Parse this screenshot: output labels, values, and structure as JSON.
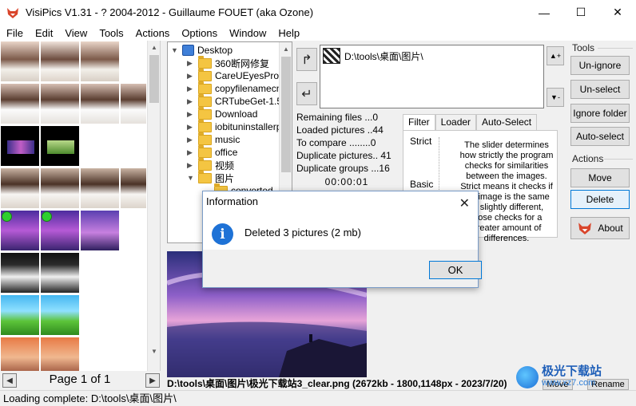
{
  "window": {
    "title": "VisiPics V1.31 - ? 2004-2012 - Guillaume FOUET (aka Ozone)",
    "minimize": "—",
    "maximize": "☐",
    "close": "✕"
  },
  "menu": [
    "File",
    "Edit",
    "View",
    "Tools",
    "Actions",
    "Options",
    "Window",
    "Help"
  ],
  "pager": {
    "label": "Page 1 of 1",
    "prev": "◀",
    "next": "▶"
  },
  "status": "Loading complete: D:\\tools\\桌面\\图片\\",
  "tree": {
    "root": "Desktop",
    "items": [
      "360断网修复",
      "CareUEyesPro",
      "copyfilenamecn",
      "CRTubeGet-1.5",
      "Download",
      "iobituninstallerpj",
      "music",
      "office",
      "视频",
      "图片",
      "converted"
    ]
  },
  "path_list": [
    "D:\\tools\\桌面\\图片\\"
  ],
  "stats": {
    "remaining": "Remaining files ...0",
    "loaded": "Loaded pictures ..44",
    "to_compare": "To compare ........0",
    "duplicates": "Duplicate pictures.. 41",
    "groups": "Duplicate groups ...16",
    "timer": "00:00:01"
  },
  "tabs": [
    "Filter",
    "Loader",
    "Auto-Select"
  ],
  "filter": {
    "strict": "Strict",
    "basic": "Basic",
    "description": "The slider determines how strictly the program checks for similarities between the images. Strict means it checks if the image is the same or slightly different, loose checks for a greater amount of differences."
  },
  "tools": {
    "title": "Tools",
    "unignore": "Un-ignore",
    "unselect": "Un-select",
    "ignore_folder": "Ignore folder",
    "auto_select": "Auto-select"
  },
  "actions": {
    "title": "Actions",
    "move": "Move",
    "delete": "Delete",
    "about": "About"
  },
  "preview": {
    "file_info": "D:\\tools\\桌面\\图片\\极光下载站3_clear.png (2672kb - 1800,1148px - 2023/7/20)",
    "move": "Move",
    "rename": "Rename"
  },
  "watermark": {
    "big": "极光下载站",
    "small": "www.xz7.com"
  },
  "dialog": {
    "title": "Information",
    "message": "Deleted 3 pictures (2 mb)",
    "ok": "OK",
    "close": "✕"
  }
}
